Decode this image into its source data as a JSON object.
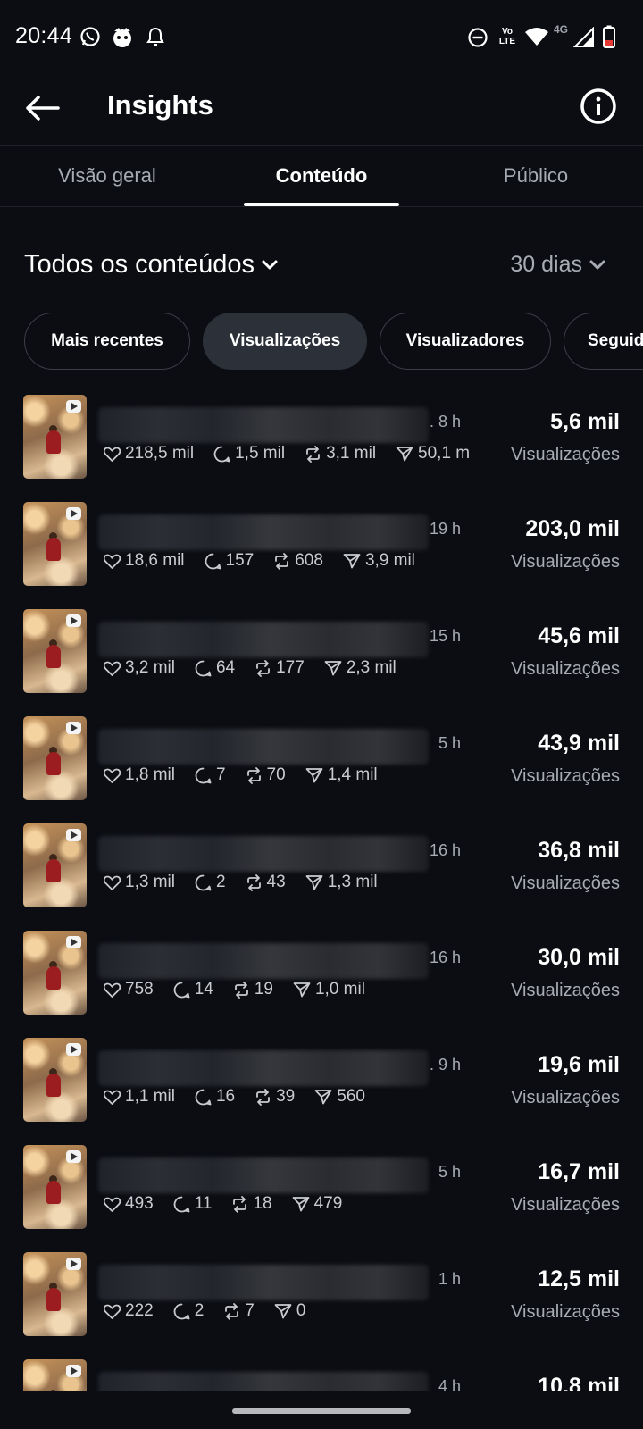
{
  "status_bar": {
    "time": "20:44",
    "left_icons": [
      "whatsapp-icon",
      "app-notification-icon",
      "bell-icon"
    ],
    "right_icons": [
      "do-not-disturb-icon",
      "volte-icon",
      "wifi-icon",
      "signal-icon",
      "battery-icon"
    ],
    "volte_label": "Vo LTE",
    "network_label": "4G",
    "battery_color": "#e53935"
  },
  "app_bar": {
    "title": "Insights"
  },
  "tabs": [
    {
      "label": "Visão geral",
      "active": false
    },
    {
      "label": "Conteúdo",
      "active": true
    },
    {
      "label": "Público",
      "active": false
    }
  ],
  "filters": {
    "content": "Todos os conteúdos",
    "range": "30 dias"
  },
  "sort_chips": [
    {
      "label": "Mais recentes",
      "active": false
    },
    {
      "label": "Visualizações",
      "active": true
    },
    {
      "label": "Visualizadores",
      "active": false
    },
    {
      "label": "Seguid",
      "active": false
    }
  ],
  "posts": [
    {
      "age": ". 8 h",
      "likes": "218,5 mil",
      "comments": "1,5 mil",
      "reposts": "3,1 mil",
      "shares": "50,1 m",
      "views": "5,6 mil",
      "views_label": "Visualizações"
    },
    {
      "age": "19 h",
      "likes": "18,6 mil",
      "comments": "157",
      "reposts": "608",
      "shares": "3,9 mil",
      "views": "203,0 mil",
      "views_label": "Visualizações"
    },
    {
      "age": "15 h",
      "likes": "3,2 mil",
      "comments": "64",
      "reposts": "177",
      "shares": "2,3 mil",
      "views": "45,6 mil",
      "views_label": "Visualizações"
    },
    {
      "age": "5 h",
      "likes": "1,8 mil",
      "comments": "7",
      "reposts": "70",
      "shares": "1,4 mil",
      "views": "43,9 mil",
      "views_label": "Visualizações"
    },
    {
      "age": "16 h",
      "likes": "1,3 mil",
      "comments": "2",
      "reposts": "43",
      "shares": "1,3 mil",
      "views": "36,8 mil",
      "views_label": "Visualizações"
    },
    {
      "age": "16 h",
      "likes": "758",
      "comments": "14",
      "reposts": "19",
      "shares": "1,0 mil",
      "views": "30,0 mil",
      "views_label": "Visualizações"
    },
    {
      "age": ". 9 h",
      "likes": "1,1 mil",
      "comments": "16",
      "reposts": "39",
      "shares": "560",
      "views": "19,6 mil",
      "views_label": "Visualizações"
    },
    {
      "age": "5 h",
      "likes": "493",
      "comments": "11",
      "reposts": "18",
      "shares": "479",
      "views": "16,7 mil",
      "views_label": "Visualizações"
    },
    {
      "age": "1 h",
      "likes": "222",
      "comments": "2",
      "reposts": "7",
      "shares": "0",
      "views": "12,5 mil",
      "views_label": "Visualizações"
    },
    {
      "age": "4 h",
      "likes": "",
      "comments": "",
      "reposts": "",
      "shares": "",
      "views": "10,8 mil",
      "views_label": ""
    }
  ]
}
